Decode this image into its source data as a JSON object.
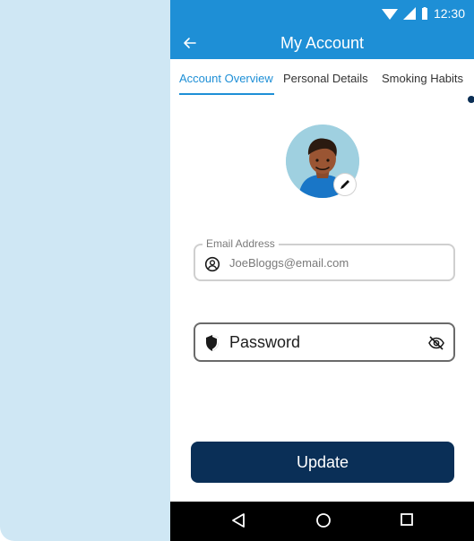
{
  "status_bar": {
    "time": "12:30",
    "icons": [
      "wifi-icon",
      "signal-icon",
      "battery-icon"
    ]
  },
  "app_bar": {
    "title": "My Account",
    "back_icon": "back-arrow-icon"
  },
  "tabs": [
    {
      "label": "Account Overview",
      "active": true
    },
    {
      "label": "Personal Details",
      "active": false
    },
    {
      "label": "Smoking Habits",
      "active": false
    }
  ],
  "profile": {
    "avatar_icon": "avatar",
    "edit_icon": "pencil-icon"
  },
  "email": {
    "label": "Email Address",
    "value": "JoeBloggs@email.com",
    "icon": "user-circle-icon"
  },
  "password": {
    "label": "Password",
    "icon": "shield-icon",
    "toggle_icon": "eye-off-icon"
  },
  "actions": {
    "update_label": "Update"
  },
  "nav_bar": {
    "back_icon": "nav-back-icon",
    "home_icon": "nav-home-icon",
    "recents_icon": "nav-recents-icon"
  },
  "colors": {
    "primary_blue": "#1e8fd6",
    "navy": "#0a2f57",
    "left_panel": "#cfe7f4"
  }
}
